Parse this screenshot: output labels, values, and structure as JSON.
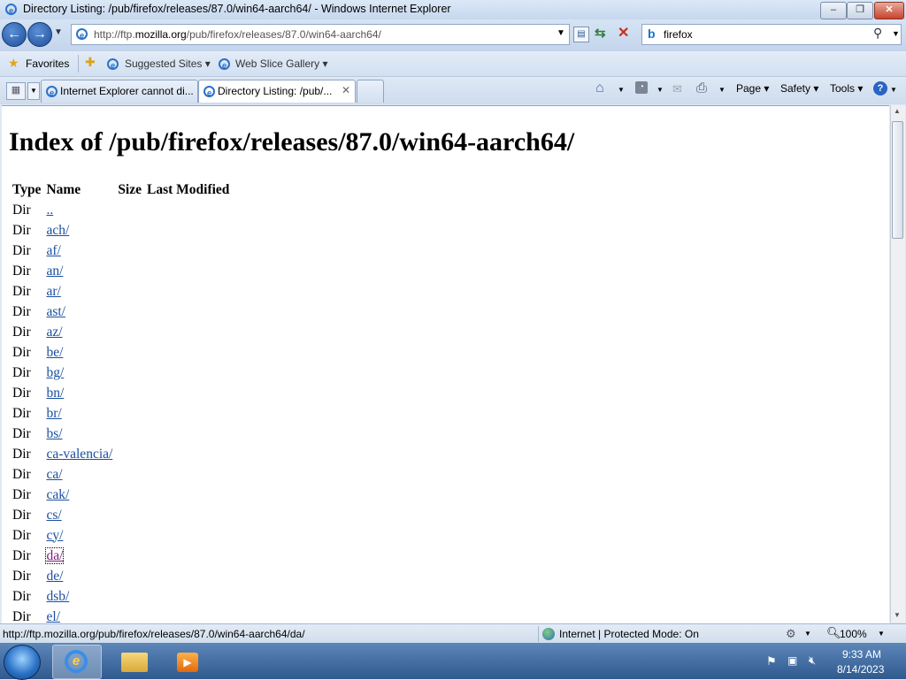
{
  "window": {
    "title": "Directory Listing: /pub/firefox/releases/87.0/win64-aarch64/ - Windows Internet Explorer",
    "minimize": "–",
    "maximize": "❐",
    "close": "✕"
  },
  "nav": {
    "back": "←",
    "forward": "→",
    "url_host": "http://ftp.",
    "url_domain": "mozilla.org",
    "url_path": "/pub/firefox/releases/87.0/win64-aarch64/",
    "search_value": "firefox"
  },
  "favorites": {
    "favorites_label": "Favorites",
    "suggested_sites": "Suggested Sites",
    "web_slice_gallery": "Web Slice Gallery"
  },
  "tabs": [
    {
      "label": "Internet Explorer cannot di..."
    },
    {
      "label": "Directory Listing: /pub/..."
    }
  ],
  "commandbar": {
    "page": "Page",
    "safety": "Safety",
    "tools": "Tools"
  },
  "page": {
    "heading": "Index of /pub/firefox/releases/87.0/win64-aarch64/",
    "columns": [
      "Type",
      "Name",
      "Size",
      "Last Modified"
    ],
    "rows": [
      {
        "type": "Dir",
        "name": ".."
      },
      {
        "type": "Dir",
        "name": "ach/"
      },
      {
        "type": "Dir",
        "name": "af/"
      },
      {
        "type": "Dir",
        "name": "an/"
      },
      {
        "type": "Dir",
        "name": "ar/"
      },
      {
        "type": "Dir",
        "name": "ast/"
      },
      {
        "type": "Dir",
        "name": "az/"
      },
      {
        "type": "Dir",
        "name": "be/"
      },
      {
        "type": "Dir",
        "name": "bg/"
      },
      {
        "type": "Dir",
        "name": "bn/"
      },
      {
        "type": "Dir",
        "name": "br/"
      },
      {
        "type": "Dir",
        "name": "bs/"
      },
      {
        "type": "Dir",
        "name": "ca-valencia/"
      },
      {
        "type": "Dir",
        "name": "ca/"
      },
      {
        "type": "Dir",
        "name": "cak/"
      },
      {
        "type": "Dir",
        "name": "cs/"
      },
      {
        "type": "Dir",
        "name": "cy/"
      },
      {
        "type": "Dir",
        "name": "da/",
        "visited": true
      },
      {
        "type": "Dir",
        "name": "de/"
      },
      {
        "type": "Dir",
        "name": "dsb/"
      },
      {
        "type": "Dir",
        "name": "el/"
      }
    ]
  },
  "status": {
    "link_url": "http://ftp.mozilla.org/pub/firefox/releases/87.0/win64-aarch64/da/",
    "zone": "Internet | Protected Mode: On",
    "zoom": "100%"
  },
  "taskbar": {
    "time": "9:33 AM",
    "date": "8/14/2023"
  },
  "colors": {
    "link": "#1a4fa0",
    "visited_link": "#7a1a7a",
    "taskbar": "#2f5a8f"
  }
}
